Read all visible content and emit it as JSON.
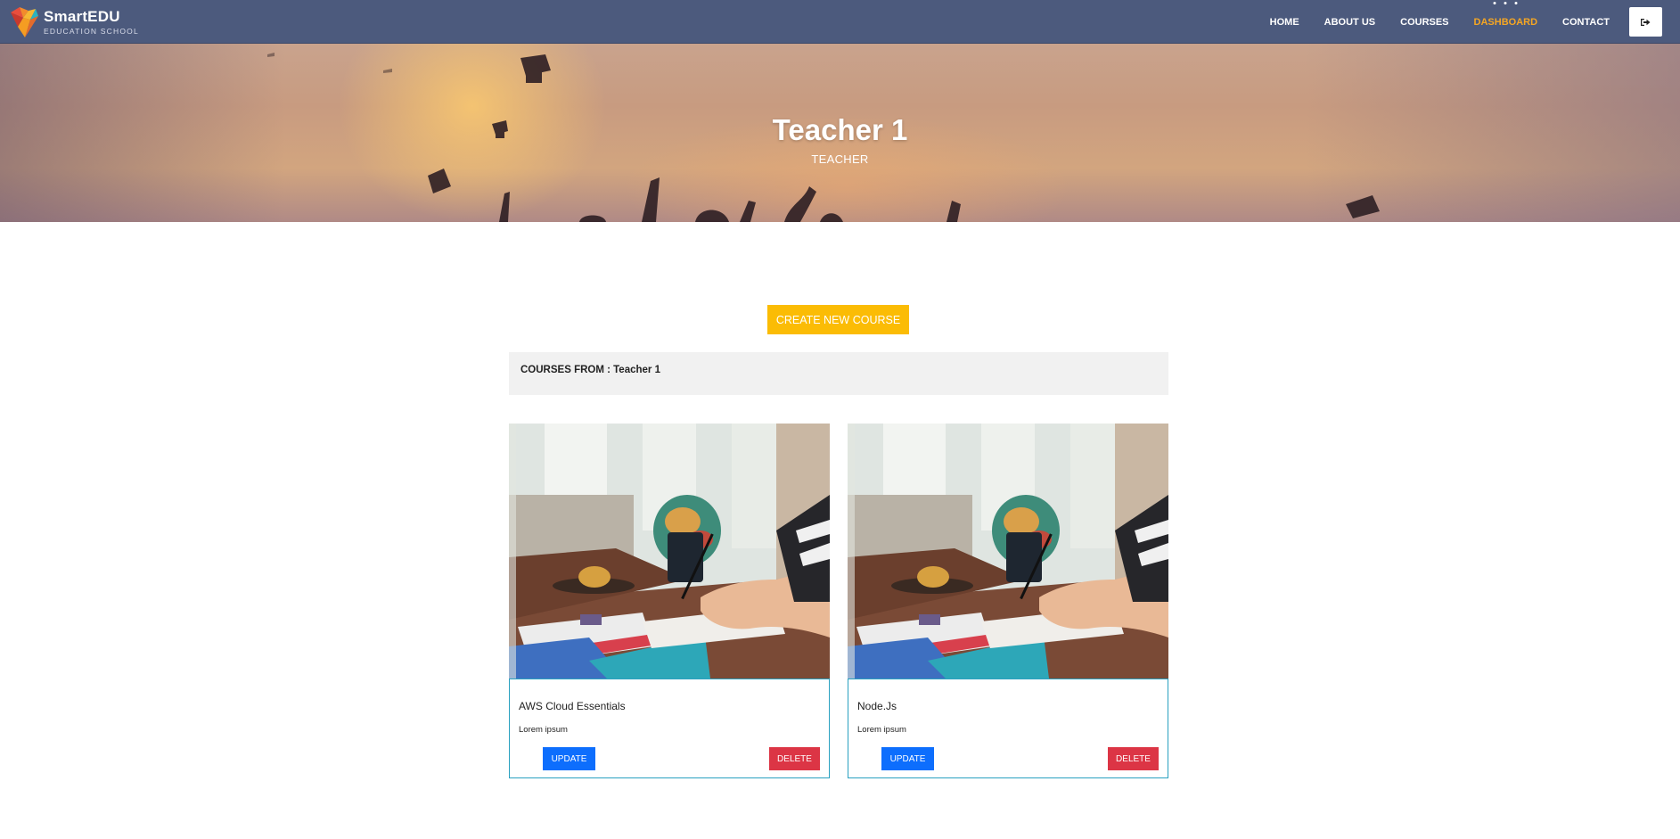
{
  "brand": {
    "name": "SmartEDU",
    "tagline": "EDUCATION SCHOOL"
  },
  "nav": {
    "items": [
      {
        "label": "HOME",
        "active": false
      },
      {
        "label": "ABOUT US",
        "active": false
      },
      {
        "label": "COURSES",
        "active": false
      },
      {
        "label": "DASHBOARD",
        "active": true
      },
      {
        "label": "CONTACT",
        "active": false
      }
    ],
    "logout_icon": "sign-out-icon"
  },
  "hero": {
    "title": "Teacher 1",
    "subtitle": "TEACHER"
  },
  "actions": {
    "create_label": "CREATE NEW COURSE"
  },
  "courses_section": {
    "heading_prefix": "COURSES FROM : ",
    "teacher": "Teacher 1"
  },
  "courses": [
    {
      "title": "AWS Cloud Essentials",
      "description": "Lorem ipsum",
      "update_label": "UPDATE",
      "delete_label": "DELETE"
    },
    {
      "title": "Node.Js",
      "description": "Lorem ipsum",
      "update_label": "UPDATE",
      "delete_label": "DELETE"
    }
  ],
  "colors": {
    "navbar": "#4c5a7d",
    "accent": "#f5a623",
    "create_button": "#fbbc05",
    "update_button": "#0d6efd",
    "delete_button": "#dc3545",
    "card_border": "#2aa1c0"
  }
}
